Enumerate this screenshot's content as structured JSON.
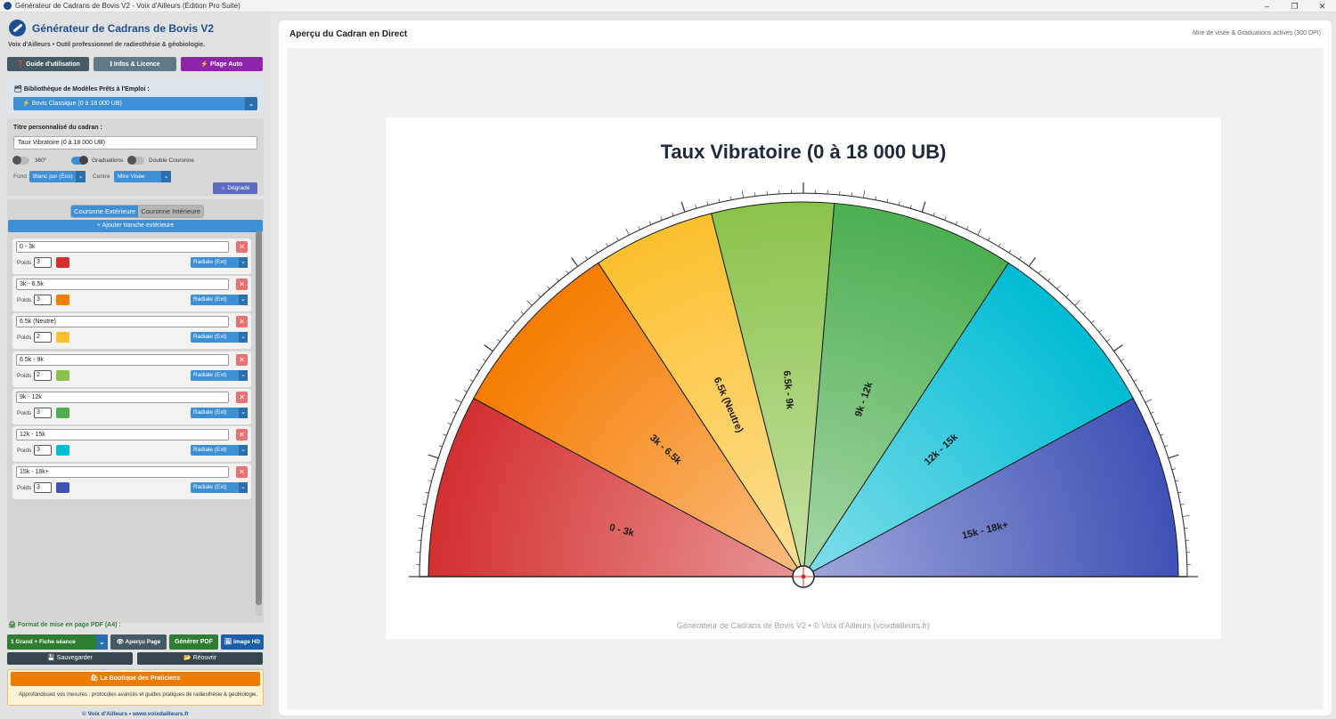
{
  "window": {
    "title": "Générateur de Cadrans de Bovis V2 - Voix d'Ailleurs (Édition Pro Suite)",
    "controls": [
      "–",
      "❐",
      "✕"
    ]
  },
  "sidebar": {
    "app_title": "Générateur de Cadrans de Bovis V2",
    "subtitle": "Voix d'Ailleurs • Outil professionnel de radiesthésie & géobiologie.",
    "buttons": {
      "guide": "❓ Guide d'utilisation",
      "info": "ℹ Infos & Licence",
      "plage": "⚡ Plage Auto"
    },
    "library": {
      "label": "🗂 Bibliothèque de Modèles Prêts à l'Emploi :",
      "selected": "⚡ Bovis Classique (0 à 18 000 UB)"
    },
    "settings": {
      "title_label": "Titre personnalisé du cadran :",
      "title_value": "Taux Vibratoire (0 à 18 000 UB)",
      "toggle_360": "360°",
      "toggle_graduations": "Graduations",
      "toggle_double": "Double Couronne",
      "fond_label": "Fond",
      "fond_value": "Blanc pur (Éco)",
      "centre_label": "Centre",
      "centre_value": "Mire Visée",
      "degrade": "☼ Dégradé"
    },
    "crowns": {
      "tab_outer": "Couronne Extérieure",
      "tab_inner": "Couronne Intérieure",
      "add_button": "+ Ajouter tranche extérieure",
      "weight_label": "Poids",
      "delete_glyph": "✕",
      "slices": [
        {
          "name": "0 - 3k",
          "weight": "3",
          "color": "#d32f2f",
          "mode": "Radiale (Ext)"
        },
        {
          "name": "3k - 6.5k",
          "weight": "3",
          "color": "#f57c00",
          "mode": "Radiale (Ext)"
        },
        {
          "name": "6.5k (Neutre)",
          "weight": "2",
          "color": "#fbc02d",
          "mode": "Radiale (Ext)"
        },
        {
          "name": "6.5k - 9k",
          "weight": "2",
          "color": "#8bc34a",
          "mode": "Radiale (Ext)"
        },
        {
          "name": "9k - 12k",
          "weight": "3",
          "color": "#4caf50",
          "mode": "Radiale (Ext)"
        },
        {
          "name": "12k - 15k",
          "weight": "3",
          "color": "#00bcd4",
          "mode": "Radiale (Ext)"
        },
        {
          "name": "15k - 18k+",
          "weight": "3",
          "color": "#3f51b5",
          "mode": "Radiale (Ext)"
        }
      ]
    },
    "pdf": {
      "label": "🖨 Format de mise en page PDF (A4) :",
      "format": "1 Grand + Fiche séance",
      "apercu": "👁 Aperçu Page",
      "generate": "Générer PDF",
      "image": "🖼 Image HD"
    },
    "save": "💾 Sauvegarder",
    "open": "📂 Réouvrir",
    "shop": {
      "button": "🛍 La Boutique des Praticiens",
      "text": "Approfondissez vos mesures : protocoles avancés et guides pratiques de radiesthésie & géobiologie."
    },
    "footer": "© Voix d'Ailleurs • www.voixdailleurs.fr"
  },
  "preview": {
    "title": "Aperçu du Cadran en Direct",
    "info": "Mire de visée & Graduations actives (300 DPI)",
    "dial_title": "Taux Vibratoire (0 à 18 000 UB)",
    "dial_footer": "Générateur de Cadrans de Bovis V2 • © Voix d'Ailleurs (voixdailleurs.fr)"
  },
  "chevron": "⌄"
}
